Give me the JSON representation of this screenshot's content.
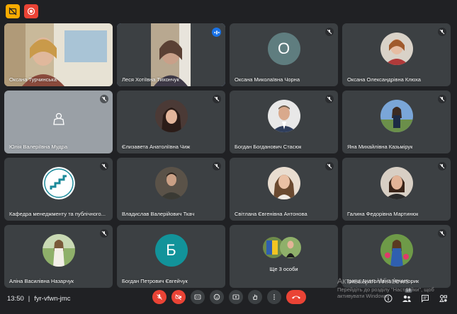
{
  "participants": [
    {
      "name": "Оксана Турчинська",
      "kind": "video",
      "muted": false
    },
    {
      "name": "Леся Хотіївна Тихончук",
      "kind": "video",
      "muted": false,
      "speaking": true
    },
    {
      "name": "Оксана Миколаївна Чорна",
      "kind": "letter",
      "letter": "О",
      "color": "#5f7d7f",
      "muted": true
    },
    {
      "name": "Оксана Олександрівна Клюха",
      "kind": "photo",
      "muted": true
    },
    {
      "name": "Юлія Валеріївна Мудра",
      "kind": "placeholder",
      "muted": true
    },
    {
      "name": "Єлизавета Анатоліївна Чиж",
      "kind": "photo",
      "muted": true
    },
    {
      "name": "Богдан Богданович Стасюк",
      "kind": "photo",
      "muted": true
    },
    {
      "name": "Яна Михайлівна Казьмірук",
      "kind": "photo",
      "muted": true
    },
    {
      "name": "Кафедра менеджменту та публічного...",
      "kind": "logo",
      "muted": true
    },
    {
      "name": "Владислав Валерійович Ткач",
      "kind": "photo",
      "muted": true
    },
    {
      "name": "Світлана Євгенівна Антонова",
      "kind": "photo",
      "muted": true
    },
    {
      "name": "Галина Федорівна Мартинюк",
      "kind": "photo",
      "muted": true
    },
    {
      "name": "Аліна Василівна Назарчук",
      "kind": "photo",
      "muted": true
    },
    {
      "name": "Богдан Петрович Євгейчук",
      "kind": "letter",
      "letter": "Б",
      "color": "#12939a",
      "muted": true
    },
    {
      "name": "Ще 3 особи",
      "kind": "group",
      "muted": false
    },
    {
      "name": "Ірина Анатоліївна Нечипорик",
      "kind": "photo",
      "muted": true
    }
  ],
  "meeting": {
    "time": "13:50",
    "separator": "|",
    "code": "fyr-vfwn-jmc"
  },
  "participant_count": "18",
  "watermark": {
    "line1": "Активация Windows",
    "line2": "Перейдіть до розділу \"Настройки\", щоб",
    "line3": "активувати Windows."
  },
  "colors": {
    "background": "#202124",
    "tile": "#3c4043",
    "accent_blue": "#8ab4f8",
    "danger_red": "#ea4335",
    "yellow": "#f9ab00"
  }
}
